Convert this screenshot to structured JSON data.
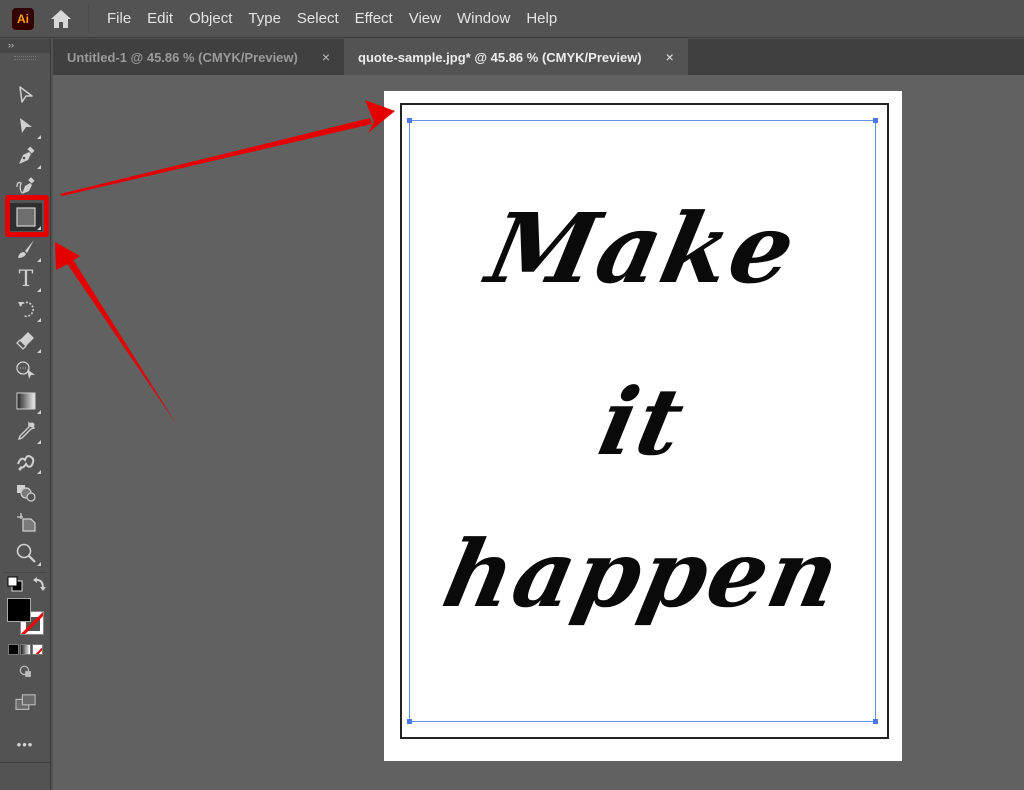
{
  "app": {
    "logo_text": "Ai",
    "home_icon": "home-icon"
  },
  "menu": {
    "items": [
      "File",
      "Edit",
      "Object",
      "Type",
      "Select",
      "Effect",
      "View",
      "Window",
      "Help"
    ]
  },
  "tabs": [
    {
      "label": "Untitled-1 @ 45.86 % (CMYK/Preview)",
      "close": "×",
      "active": false
    },
    {
      "label": "quote-sample.jpg* @ 45.86 % (CMYK/Preview)",
      "close": "×",
      "active": true
    }
  ],
  "toolbar": {
    "collapse_label": "››",
    "tools": [
      {
        "name": "selection-tool",
        "icon": "selection-arrow-icon"
      },
      {
        "name": "direct-selection-tool",
        "icon": "direct-selection-arrow-icon"
      },
      {
        "name": "pen-tool",
        "icon": "pen-icon"
      },
      {
        "name": "curvature-tool",
        "icon": "curvature-pen-icon"
      },
      {
        "name": "rectangle-tool",
        "icon": "rectangle-icon",
        "selected": true
      },
      {
        "name": "paintbrush-tool",
        "icon": "paintbrush-icon"
      },
      {
        "name": "type-tool",
        "icon": "type-icon",
        "glyph": "T"
      },
      {
        "name": "rotate-tool",
        "icon": "rotate-icon"
      },
      {
        "name": "eraser-tool",
        "icon": "eraser-icon"
      },
      {
        "name": "shape-builder-tool",
        "icon": "shape-builder-icon"
      },
      {
        "name": "gradient-tool",
        "icon": "gradient-icon"
      },
      {
        "name": "eyedropper-tool",
        "icon": "eyedropper-icon"
      },
      {
        "name": "blend-tool",
        "icon": "blend-icon"
      },
      {
        "name": "symbol-sprayer-tool",
        "icon": "symbol-sprayer-icon"
      },
      {
        "name": "artboard-tool",
        "icon": "artboard-icon"
      },
      {
        "name": "zoom-tool",
        "icon": "magnifier-icon"
      }
    ],
    "fill_color": "#000000",
    "stroke": "none",
    "more_label": "•••"
  },
  "document": {
    "quote_lines": [
      "Make",
      "it",
      "happen"
    ]
  },
  "annotation": {
    "color": "#e50000"
  }
}
